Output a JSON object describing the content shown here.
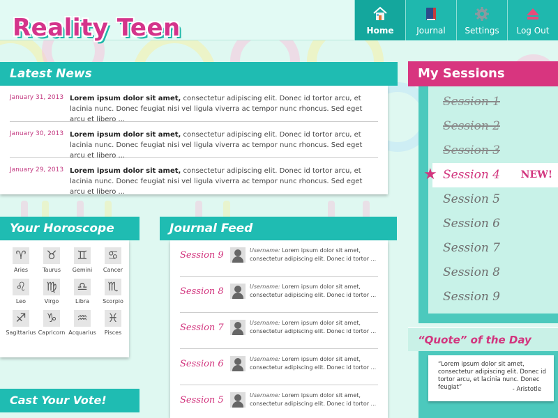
{
  "app": {
    "logo": "Reality Teen"
  },
  "nav": {
    "items": [
      {
        "label": "Home",
        "icon": "home-icon",
        "active": true
      },
      {
        "label": "Journal",
        "icon": "journal-icon",
        "active": false
      },
      {
        "label": "Settings",
        "icon": "gear-icon",
        "active": false
      },
      {
        "label": "Log Out",
        "icon": "logout-icon",
        "active": false
      }
    ]
  },
  "news": {
    "title": "Latest News",
    "items": [
      {
        "date": "January 31, 2013",
        "headline": "Lorem ipsum dolor sit amet,",
        "body": " consectetur adipiscing elit. Donec id tortor arcu, et lacinia nunc. Donec feugiat nisi vel ligula viverra ac tempor nunc rhoncus. Sed eget arcu et libero ..."
      },
      {
        "date": "January 30, 2013",
        "headline": "Lorem ipsum dolor sit amet,",
        "body": " consectetur adipiscing elit. Donec id tortor arcu, et lacinia nunc. Donec feugiat nisi vel ligula viverra ac tempor nunc rhoncus. Sed eget arcu et libero ..."
      },
      {
        "date": "January 29, 2013",
        "headline": "Lorem ipsum dolor sit amet,",
        "body": " consectetur adipiscing elit. Donec id tortor arcu, et lacinia nunc. Donec feugiat nisi vel ligula viverra ac tempor nunc rhoncus. Sed eget arcu et libero ..."
      }
    ]
  },
  "horoscope": {
    "title": "Your Horoscope",
    "signs": [
      {
        "label": "Aries",
        "glyph": "♈"
      },
      {
        "label": "Taurus",
        "glyph": "♉"
      },
      {
        "label": "Gemini",
        "glyph": "♊"
      },
      {
        "label": "Cancer",
        "glyph": "♋"
      },
      {
        "label": "Leo",
        "glyph": "♌"
      },
      {
        "label": "Virgo",
        "glyph": "♍"
      },
      {
        "label": "Libra",
        "glyph": "♎"
      },
      {
        "label": "Scorpio",
        "glyph": "♏"
      },
      {
        "label": "Sagittarius",
        "glyph": "♐"
      },
      {
        "label": "Capricorn",
        "glyph": "♑"
      },
      {
        "label": "Acquarius",
        "glyph": "♒"
      },
      {
        "label": "Pisces",
        "glyph": "♓"
      }
    ]
  },
  "journal": {
    "title": "Journal Feed",
    "items": [
      {
        "session": "Session 9",
        "user": "Username:",
        "text": " Lorem ipsum dolor sit amet, consectetur adipiscing elit. Donec id tortor ..."
      },
      {
        "session": "Session 8",
        "user": "Username:",
        "text": " Lorem ipsum dolor sit amet, consectetur adipiscing elit. Donec id tortor ..."
      },
      {
        "session": "Session 7",
        "user": "Username:",
        "text": " Lorem ipsum dolor sit amet, consectetur adipiscing elit. Donec id tortor ..."
      },
      {
        "session": "Session 6",
        "user": "Username:",
        "text": " Lorem ipsum dolor sit amet, consectetur adipiscing elit. Donec id tortor ..."
      },
      {
        "session": "Session 5",
        "user": "Username:",
        "text": " Lorem ipsum dolor sit amet, consectetur adipiscing elit. Donec id tortor ..."
      }
    ]
  },
  "sessions": {
    "title": "My Sessions",
    "new_badge": "NEW!",
    "items": [
      {
        "label": "Session 1",
        "state": "done"
      },
      {
        "label": "Session 2",
        "state": "done"
      },
      {
        "label": "Session 3",
        "state": "done"
      },
      {
        "label": "Session 4",
        "state": "current"
      },
      {
        "label": "Session 5",
        "state": "locked"
      },
      {
        "label": "Session 6",
        "state": "locked"
      },
      {
        "label": "Session 7",
        "state": "locked"
      },
      {
        "label": "Session 8",
        "state": "locked"
      },
      {
        "label": "Session 9",
        "state": "locked"
      }
    ]
  },
  "quote": {
    "title": "“Quote” of the Day",
    "text": "“Lorem ipsum dolor sit amet, consectetur adipiscing elit. Donec id tortor arcu, et lacinia nunc. Donec feugiat”",
    "author": "- Aristotle"
  },
  "vote": {
    "title": "Cast Your Vote!"
  },
  "colors": {
    "teal": "#1fbcb2",
    "pink": "#d2357e",
    "mint": "#dff8f1"
  }
}
